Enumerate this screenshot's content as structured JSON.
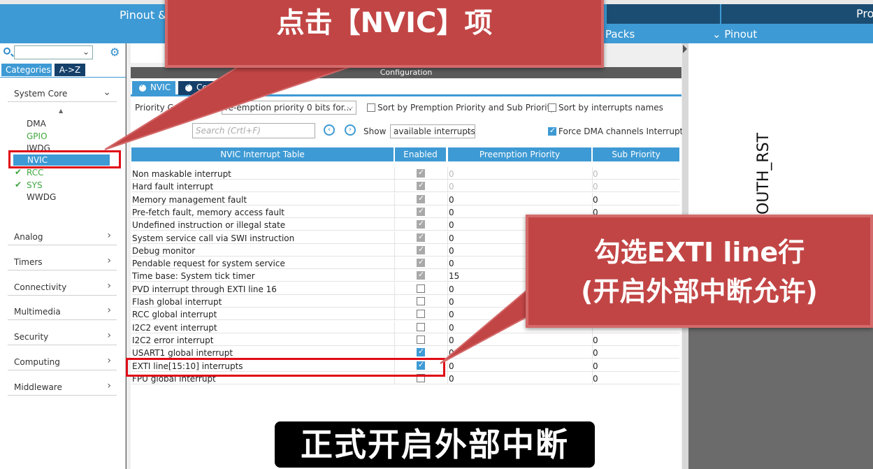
{
  "window": {
    "title_tab_1": "Pinout &",
    "title_tab_2": "Pro",
    "packs_label": "Packs",
    "pinout_menu": "Pinout"
  },
  "sidebar": {
    "tabs": [
      "Categories",
      "A->Z"
    ],
    "sections": [
      {
        "label": "System Core",
        "expanded": true
      },
      {
        "label": "Analog"
      },
      {
        "label": "Timers"
      },
      {
        "label": "Connectivity"
      },
      {
        "label": "Multimedia"
      },
      {
        "label": "Security"
      },
      {
        "label": "Computing"
      },
      {
        "label": "Middleware"
      }
    ],
    "peripherals": [
      {
        "label": "DMA",
        "state": "plain",
        "checked": false
      },
      {
        "label": "GPIO",
        "state": "green",
        "checked": false
      },
      {
        "label": "IWDG",
        "state": "plain",
        "checked": false
      },
      {
        "label": "NVIC",
        "state": "selected",
        "checked": false
      },
      {
        "label": "RCC",
        "state": "green",
        "checked": true
      },
      {
        "label": "SYS",
        "state": "green",
        "checked": true
      },
      {
        "label": "WWDG",
        "state": "plain",
        "checked": false
      }
    ]
  },
  "config": {
    "header": "Configuration",
    "tabs": [
      "NVIC",
      "Co"
    ],
    "priority_group_label": "Priority Gro",
    "priority_group_value": "re-emption priority 0 bits for...",
    "sort_priority_label": "Sort by Premption Priority and Sub Priority",
    "sort_names_label": "Sort by interrupts names",
    "search_placeholder": "Search (Crtl+F)",
    "show_label": "Show",
    "show_value": "available interrupts",
    "force_dma_label": "Force DMA channels Interrupts",
    "table": {
      "headers": [
        "NVIC Interrupt Table",
        "Enabled",
        "Preemption Priority",
        "Sub Priority"
      ],
      "rows": [
        {
          "name": "Non maskable interrupt",
          "enabled": "locked",
          "pre": "0",
          "sub": "0",
          "dim": true
        },
        {
          "name": "Hard fault interrupt",
          "enabled": "locked",
          "pre": "0",
          "sub": "0",
          "dim": true
        },
        {
          "name": "Memory management fault",
          "enabled": "locked",
          "pre": "0",
          "sub": "0"
        },
        {
          "name": "Pre-fetch fault, memory access fault",
          "enabled": "locked",
          "pre": "0",
          "sub": "0"
        },
        {
          "name": "Undefined instruction or illegal state",
          "enabled": "locked",
          "pre": "0",
          "sub": ""
        },
        {
          "name": "System service call via SWI instruction",
          "enabled": "locked",
          "pre": "0",
          "sub": ""
        },
        {
          "name": "Debug monitor",
          "enabled": "locked",
          "pre": "0",
          "sub": ""
        },
        {
          "name": "Pendable request for system service",
          "enabled": "locked",
          "pre": "0",
          "sub": ""
        },
        {
          "name": "Time base: System tick timer",
          "enabled": "locked",
          "pre": "15",
          "sub": ""
        },
        {
          "name": "PVD interrupt through EXTI line 16",
          "enabled": "off",
          "pre": "0",
          "sub": ""
        },
        {
          "name": "Flash global interrupt",
          "enabled": "off",
          "pre": "0",
          "sub": ""
        },
        {
          "name": "RCC global interrupt",
          "enabled": "off",
          "pre": "0",
          "sub": ""
        },
        {
          "name": "I2C2 event interrupt",
          "enabled": "off",
          "pre": "0",
          "sub": ""
        },
        {
          "name": "I2C2 error interrupt",
          "enabled": "off",
          "pre": "0",
          "sub": "0"
        },
        {
          "name": "USART1 global interrupt",
          "enabled": "on",
          "pre": "0",
          "sub": "0"
        },
        {
          "name": "EXTI line[15:10] interrupts",
          "enabled": "on",
          "pre": "0",
          "sub": "0"
        },
        {
          "name": "FPU global interrupt",
          "enabled": "off",
          "pre": "0",
          "sub": "0"
        }
      ]
    }
  },
  "right_panel": {
    "pin_label": "OUTH_RST"
  },
  "annotations": {
    "callout_top": "点击【NVIC】项",
    "callout_right_line1": "勾选EXTI line行",
    "callout_right_line2": "(开启外部中断允许)",
    "subtitle": "正式开启外部中断"
  },
  "colors": {
    "accent": "#3e9ad4",
    "dark_tab": "#15406a",
    "callout_bg": "#c24545",
    "highlight_red": "#e00b16",
    "ok_green": "#3fa63f"
  }
}
